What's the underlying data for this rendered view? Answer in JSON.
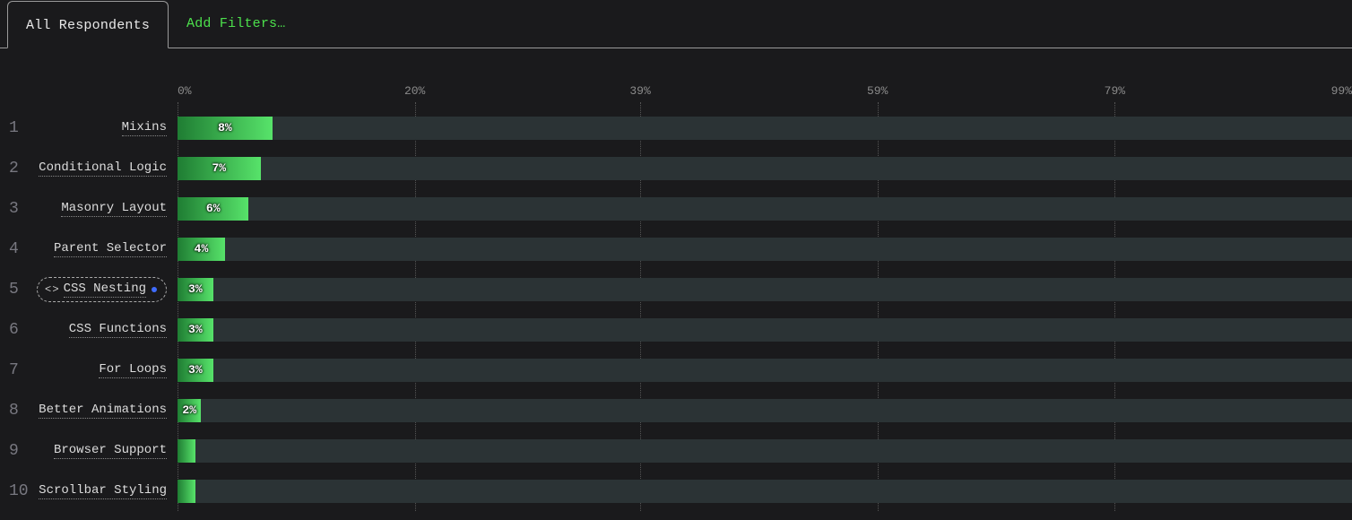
{
  "tabs": {
    "active_label": "All Respondents",
    "add_label": "Add Filters…"
  },
  "chart_data": {
    "type": "bar",
    "orientation": "horizontal",
    "xlabel": "",
    "ylabel": "",
    "xlim": [
      0,
      99
    ],
    "ticks": [
      0,
      20,
      39,
      59,
      79,
      99
    ],
    "tick_labels": [
      "0%",
      "20%",
      "39%",
      "59%",
      "79%",
      "99%"
    ],
    "series": [
      {
        "rank": 1,
        "label": "Mixins",
        "value": 8,
        "display": "8%",
        "chip": false
      },
      {
        "rank": 2,
        "label": "Conditional Logic",
        "value": 7,
        "display": "7%",
        "chip": false
      },
      {
        "rank": 3,
        "label": "Masonry Layout",
        "value": 6,
        "display": "6%",
        "chip": false
      },
      {
        "rank": 4,
        "label": "Parent Selector",
        "value": 4,
        "display": "4%",
        "chip": false
      },
      {
        "rank": 5,
        "label": "CSS Nesting",
        "value": 3,
        "display": "3%",
        "chip": true
      },
      {
        "rank": 6,
        "label": "CSS Functions",
        "value": 3,
        "display": "3%",
        "chip": false
      },
      {
        "rank": 7,
        "label": "For Loops",
        "value": 3,
        "display": "3%",
        "chip": false
      },
      {
        "rank": 8,
        "label": "Better Animations",
        "value": 2,
        "display": "2%",
        "chip": false
      },
      {
        "rank": 9,
        "label": "Browser Support",
        "value": 1.5,
        "display": "",
        "chip": false
      },
      {
        "rank": 10,
        "label": "Scrollbar Styling",
        "value": 1.5,
        "display": "",
        "chip": false
      }
    ]
  }
}
